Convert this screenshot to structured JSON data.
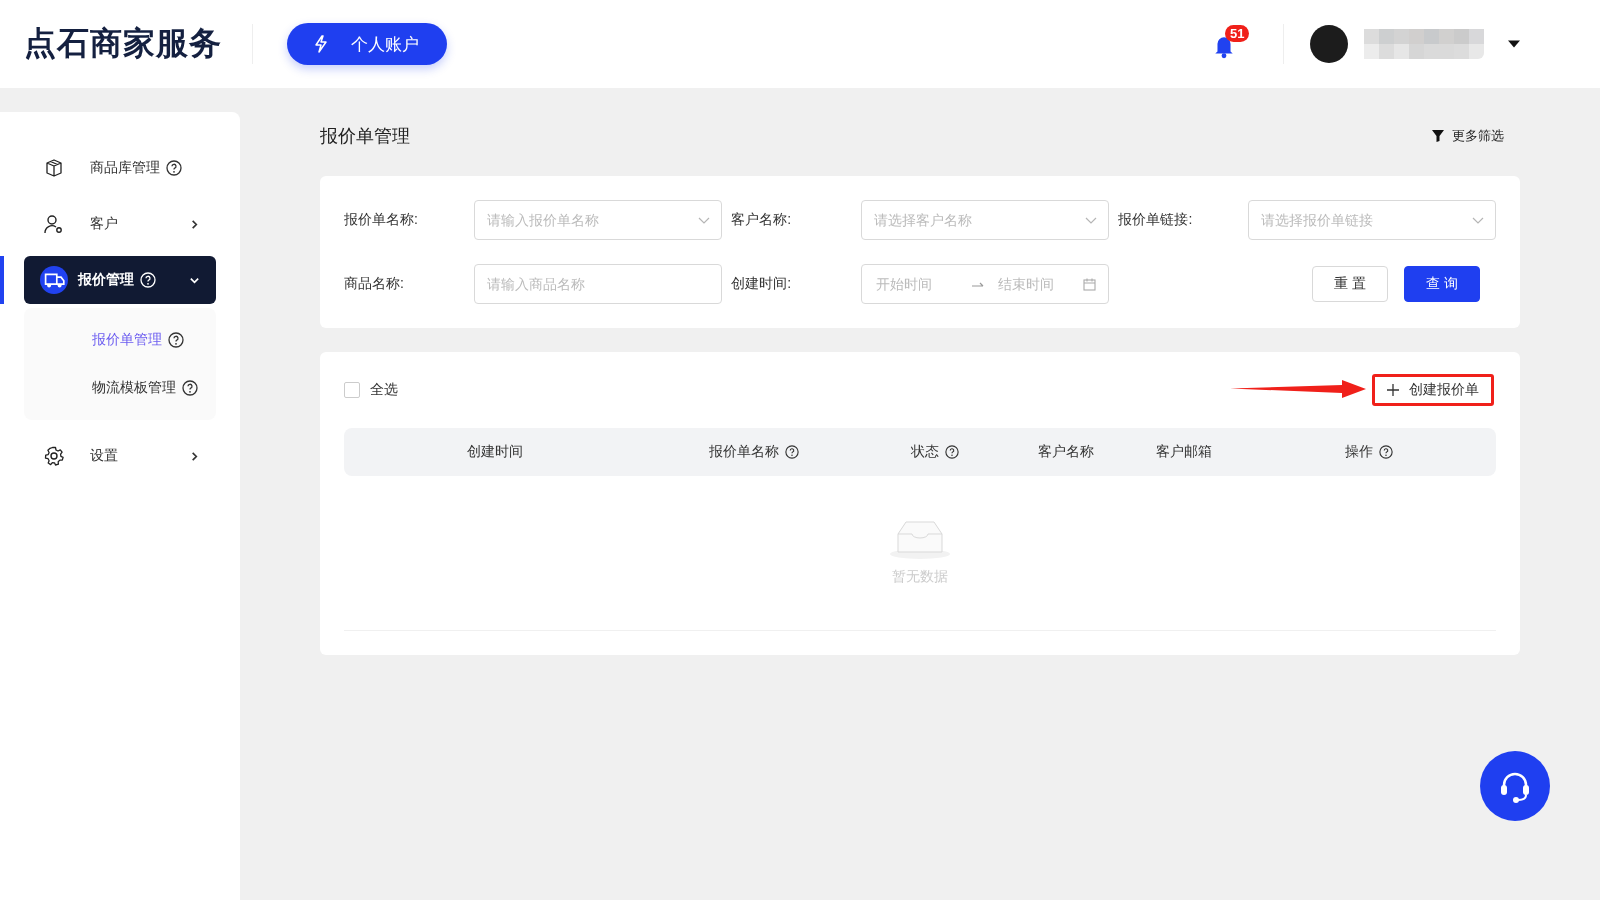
{
  "header": {
    "logo": "点石商家服务",
    "account_button": "个人账户",
    "notifications": {
      "count": "51"
    },
    "user": {
      "name_blurred": true
    }
  },
  "sidebar": {
    "items": [
      {
        "kind": "link",
        "label": "商品库管理",
        "help": true,
        "selected": false
      },
      {
        "kind": "group",
        "label": "客户",
        "help": false,
        "selected": false,
        "expanded": false
      },
      {
        "kind": "group",
        "label": "报价管理",
        "help": true,
        "selected": true,
        "expanded": true,
        "children": [
          {
            "label": "报价单管理",
            "help": true,
            "selected": true
          },
          {
            "label": "物流模板管理",
            "help": true,
            "selected": false
          }
        ]
      },
      {
        "kind": "group",
        "label": "设置",
        "help": false,
        "selected": false,
        "expanded": false
      }
    ]
  },
  "page": {
    "title": "报价单管理",
    "more_filters": "更多筛选"
  },
  "filters": {
    "fields": [
      {
        "kind": "select",
        "label": "报价单名称:",
        "placeholder": "请输入报价单名称"
      },
      {
        "kind": "select",
        "label": "客户名称:",
        "placeholder": "请选择客户名称"
      },
      {
        "kind": "select",
        "label": "报价单链接:",
        "placeholder": "请选择报价单链接"
      },
      {
        "kind": "text",
        "label": "商品名称:",
        "placeholder": "请输入商品名称"
      },
      {
        "kind": "daterange",
        "label": "创建时间:",
        "placeholder": "开始时间",
        "placeholder_end": "结束时间"
      }
    ],
    "buttons": [
      {
        "kind": "default",
        "label": "重 置"
      },
      {
        "kind": "primary",
        "label": "查 询"
      }
    ]
  },
  "table": {
    "select_all": {
      "label": "全选",
      "checked": false
    },
    "create_button": {
      "label": "创建报价单",
      "highlighted": true
    },
    "columns": [
      {
        "label": "创建时间",
        "help": false
      },
      {
        "label": "报价单名称",
        "help": true
      },
      {
        "label": "状态",
        "help": true
      },
      {
        "label": "客户名称",
        "help": false
      },
      {
        "label": "客户邮箱",
        "help": false
      },
      {
        "label": "操作",
        "help": true
      }
    ],
    "empty_text": "暂无数据"
  }
}
